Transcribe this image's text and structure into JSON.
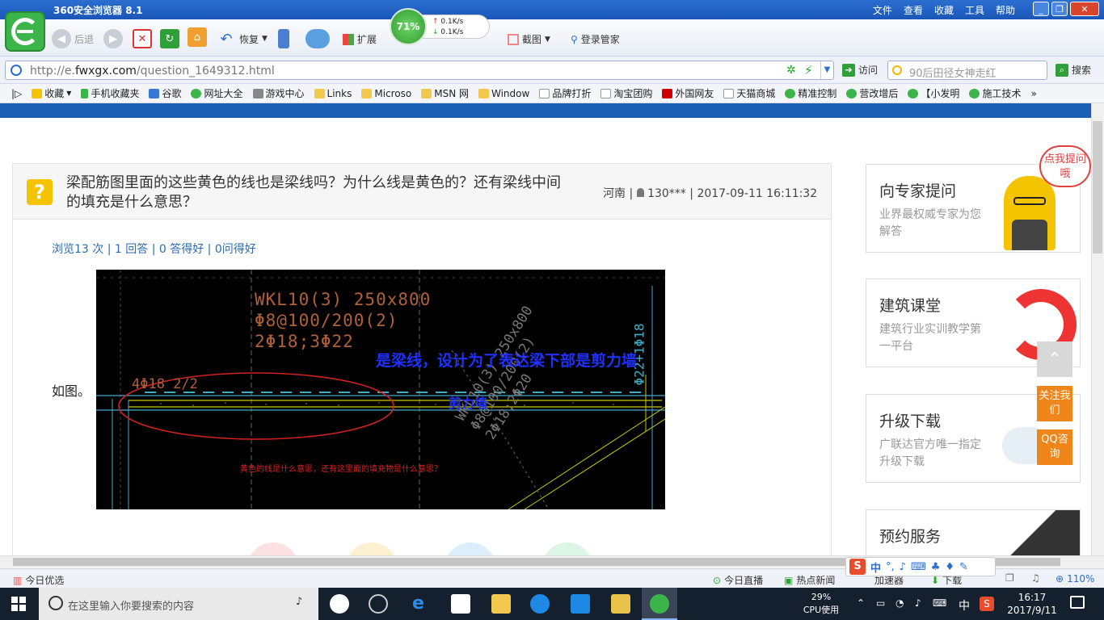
{
  "browser": {
    "title": "360安全浏览器 8.1",
    "menu": [
      "文件",
      "查看",
      "收藏",
      "工具",
      "帮助"
    ],
    "toolbar": {
      "back": "后退",
      "restore": "恢复",
      "extend": "扩展",
      "screenshot": "截图",
      "login": "登录管家"
    },
    "speed": {
      "percent": "71%",
      "up": "0.1K/s",
      "down": "0.1K/s"
    },
    "url_prefix": "http://e.",
    "url_domain": "fwxgx.com",
    "url_path": "/question_1649312.html",
    "visit": "访问",
    "search_placeholder": "90后田径女神走红",
    "search_button": "搜索",
    "bookmarks": [
      "收藏",
      "手机收藏夹",
      "谷歌",
      "网址大全",
      "游戏中心",
      "Links",
      "Microso",
      "MSN 网",
      "Window",
      "品牌打折",
      "淘宝团购",
      "外国网友",
      "天猫商城",
      "精准控制",
      "营改增后",
      "【小发明",
      "施工技术"
    ]
  },
  "question": {
    "title": "梁配筋图里面的这些黄色的线也是梁线吗？为什么线是黄色的？还有梁线中间的填充是什么意思？",
    "location": "河南",
    "user": "130***",
    "datetime": "2017-09-11 16:11:32",
    "stats": "浏览13 次 | 1 回答 | 0 答得好 | 0问得好",
    "body_text": "如图。"
  },
  "cad": {
    "beam1_l1": "WKL10(3) 250x800",
    "beam1_l2": "Φ8@100/200(2)",
    "beam1_l3": "2Φ18;3Φ22",
    "left_rebar": "4Φ18 2/2",
    "side_label": "Φ22+1Φ18",
    "annot_blue1": "是梁线，设计为了表达梁下部是剪力墙",
    "annot_blue2": "剪力墙",
    "annot_red": "黄色的线是什么意思，还有这里面的填充物是什么意思？",
    "beam2_l1": "WKL10(3) 250x800",
    "beam2_l2": "Φ8@100/200(2)",
    "beam2_l3": "2Φ18;2Φ20"
  },
  "sidebar": {
    "cards": [
      {
        "title": "向专家提问",
        "sub": "业界最权威专家为您解答"
      },
      {
        "title": "建筑课堂",
        "sub": "建筑行业实训教学第一平台"
      },
      {
        "title": "升级下载",
        "sub": "广联达官方唯一指定升级下载"
      },
      {
        "title": "预约服务",
        "sub": ""
      }
    ],
    "bubble": "点我提问哦",
    "follow": "关注我们",
    "qq": "QQ咨询"
  },
  "statusbar": {
    "left": "今日优选",
    "live": "今日直播",
    "news": "热点新闻",
    "accel": "加速器",
    "download": "下载",
    "zoom": "110%"
  },
  "taskbar": {
    "search_placeholder": "在这里输入你要搜索的内容",
    "cpu_pct": "29%",
    "cpu_label": "CPU使用",
    "ime": "中",
    "time": "16:17",
    "date": "2017/9/11"
  },
  "colors": {
    "accent": "#1a5fb4",
    "orange": "#f08519",
    "green": "#3bb54a"
  }
}
